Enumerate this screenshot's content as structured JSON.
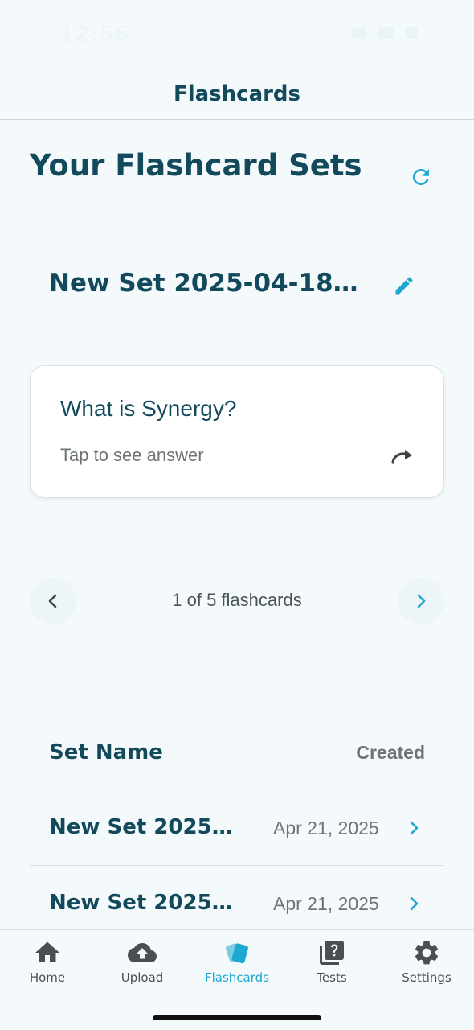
{
  "status_bar": {
    "time": "12:56"
  },
  "header": {
    "title": "Flashcards"
  },
  "page": {
    "title": "Your Flashcard Sets",
    "refresh_icon": "refresh-icon"
  },
  "current_set": {
    "name": "New Set 2025-04-18 2...",
    "edit_icon": "pencil-icon"
  },
  "flashcard": {
    "question": "What is Synergy?",
    "hint": "Tap to see answer",
    "flip_icon": "redo-arrow-icon"
  },
  "pager": {
    "label": "1 of 5 flashcards",
    "current": 1,
    "total": 5
  },
  "table": {
    "columns": {
      "name": "Set Name",
      "created": "Created"
    },
    "rows": [
      {
        "name": "New Set 2025-0...",
        "created": "Apr 21, 2025"
      },
      {
        "name": "New Set 2025-0...",
        "created": "Apr 21, 2025"
      }
    ]
  },
  "tabs": [
    {
      "label": "Home",
      "icon": "home-icon",
      "active": false
    },
    {
      "label": "Upload",
      "icon": "cloud-upload-icon",
      "active": false
    },
    {
      "label": "Flashcards",
      "icon": "cards-icon",
      "active": true
    },
    {
      "label": "Tests",
      "icon": "quiz-icon",
      "active": false
    },
    {
      "label": "Settings",
      "icon": "gear-icon",
      "active": false
    }
  ],
  "colors": {
    "primary_text": "#124a5c",
    "accent": "#1ca8d0",
    "background": "#f4fafc",
    "muted_text": "#6d7478"
  }
}
